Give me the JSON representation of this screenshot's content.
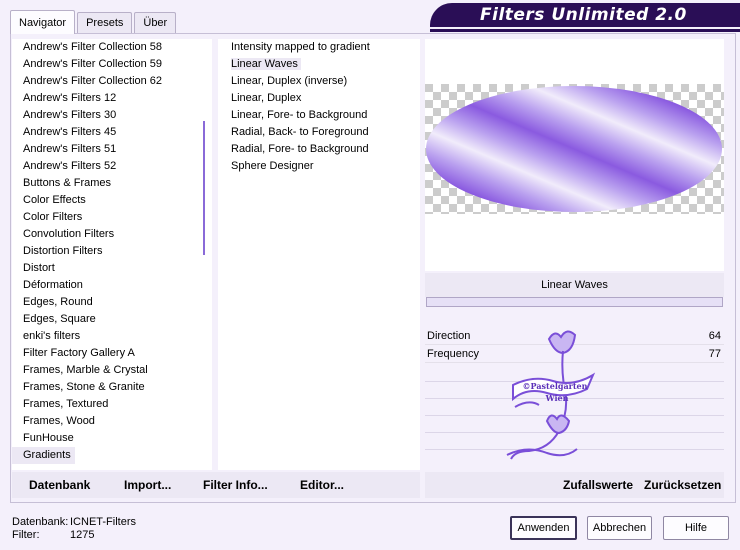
{
  "window": {
    "title": "Filters Unlimited 2.0"
  },
  "tabs": [
    "Navigator",
    "Presets",
    "Über"
  ],
  "categories": [
    "Andrew's Filter Collection 58",
    "Andrew's Filter Collection 59",
    "Andrew's Filter Collection 62",
    "Andrew's Filters 12",
    "Andrew's Filters 30",
    "Andrew's Filters 45",
    "Andrew's Filters 51",
    "Andrew's Filters 52",
    "Buttons & Frames",
    "Color Effects",
    "Color Filters",
    "Convolution Filters",
    "Distortion Filters",
    "Distort",
    "Déformation",
    "Edges, Round",
    "Edges, Square",
    "enki's filters",
    "Filter Factory Gallery A",
    "Frames, Marble & Crystal",
    "Frames, Stone & Granite",
    "Frames, Textured",
    "Frames, Wood",
    "FunHouse",
    "Gradients"
  ],
  "selected_category": "Gradients",
  "filters": [
    "Intensity mapped to gradient",
    "Linear Waves",
    "Linear, Duplex (inverse)",
    "Linear, Duplex",
    "Linear, Fore- to Background",
    "Radial, Back- to Foreground",
    "Radial, Fore- to Background",
    "Sphere Designer"
  ],
  "selected_filter": "Linear Waves",
  "preview": {
    "filter_name": "Linear Waves"
  },
  "params": [
    {
      "label": "Direction",
      "value": "64"
    },
    {
      "label": "Frequency",
      "value": "77"
    }
  ],
  "watermark": {
    "line1": "©Pastelgarten",
    "line2": "Wien"
  },
  "toolbar": {
    "datenbank": "Datenbank",
    "import": "Import...",
    "filter_info": "Filter Info...",
    "editor": "Editor...",
    "zufallswerte": "Zufallswerte",
    "zuruecksetzen": "Zurücksetzen"
  },
  "status": {
    "datenbank_label": "Datenbank:",
    "datenbank_value": "ICNET-Filters",
    "filter_label": "Filter:",
    "filter_value": "1275"
  },
  "buttons": {
    "anwenden": "Anwenden",
    "abbrechen": "Abbrechen",
    "hilfe": "Hilfe"
  },
  "colors": {
    "accent": "#8a5ae0",
    "title_bg": "#2a0e56",
    "panel_bg": "#f4f0fb"
  }
}
